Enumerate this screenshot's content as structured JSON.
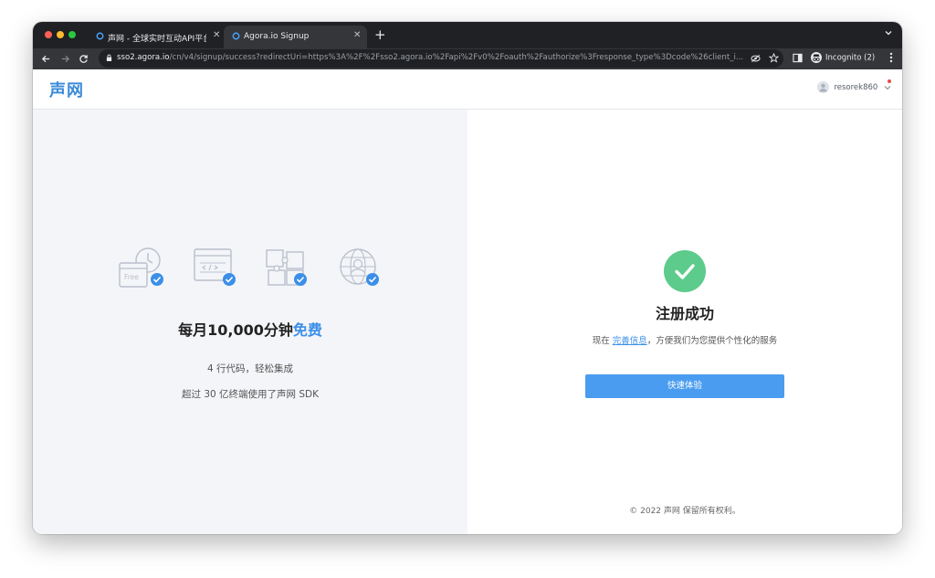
{
  "browser": {
    "tabs": [
      {
        "title": "声网 - 全球实时互动API平台开创",
        "close": "✕"
      },
      {
        "title": "Agora.io Signup",
        "close": "✕"
      }
    ],
    "new_tab": "+",
    "url_host": "sso2.agora.io",
    "url_path": "/cn/v4/signup/success?redirectUri=https%3A%2F%2Fsso2.agora.io%2Fapi%2Fv0%2Foauth%2Fauthorize%3Fresponse_type%3Dcode%26client_i...",
    "incognito_label": "Incognito (2)"
  },
  "header": {
    "logo": "声网",
    "username": "resorek860"
  },
  "left_panel": {
    "free_label": "Free",
    "headline_main": "每月10,000分钟",
    "headline_highlight": "免费",
    "line1": "4 行代码，轻松集成",
    "line2": "超过 30 亿终端使用了声网 SDK"
  },
  "right_panel": {
    "title": "注册成功",
    "desc_prefix": "现在 ",
    "desc_link": "完善信息",
    "desc_suffix": "，方便我们为您提供个性化的服务",
    "button": "快速体验",
    "copyright": "© 2022 声网 保留所有权利。"
  },
  "colors": {
    "brand_blue": "#3b8fe8",
    "success_green": "#5ccb8b",
    "button_blue": "#4a9cf0"
  }
}
